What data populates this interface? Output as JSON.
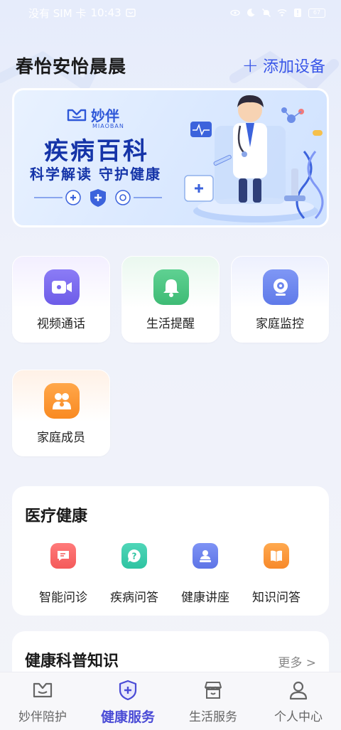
{
  "status_bar": {
    "carrier": "没有 SIM 卡",
    "time": "10:43",
    "battery": "67"
  },
  "header": {
    "title": "春怡安怡晨晨",
    "add_device": "添加设备"
  },
  "banner": {
    "logo_text": "妙伴",
    "logo_sub": "MIAOBAN",
    "title": "疾病百科",
    "subtitle": "科学解读  守护健康"
  },
  "quick_cards": [
    {
      "label": "视频通话",
      "icon": "video-icon"
    },
    {
      "label": "生活提醒",
      "icon": "bell-icon"
    },
    {
      "label": "家庭监控",
      "icon": "camera-icon"
    },
    {
      "label": "家庭成员",
      "icon": "family-icon"
    }
  ],
  "medical": {
    "title": "医疗健康",
    "items": [
      {
        "label": "智能问诊",
        "icon": "chat-icon"
      },
      {
        "label": "疾病问答",
        "icon": "question-icon"
      },
      {
        "label": "健康讲座",
        "icon": "lecture-icon"
      },
      {
        "label": "知识问答",
        "icon": "book-icon"
      }
    ]
  },
  "knowledge": {
    "title": "健康科普知识",
    "more": "更多 >"
  },
  "tabs": [
    {
      "label": "妙伴陪护",
      "icon": "companion-icon",
      "active": false
    },
    {
      "label": "健康服务",
      "icon": "health-shield-icon",
      "active": true
    },
    {
      "label": "生活服务",
      "icon": "store-icon",
      "active": false
    },
    {
      "label": "个人中心",
      "icon": "person-icon",
      "active": false
    }
  ],
  "colors": {
    "accent": "#3a57e8",
    "active_tab": "#4a4bd6",
    "banner_title": "#1534a8"
  }
}
